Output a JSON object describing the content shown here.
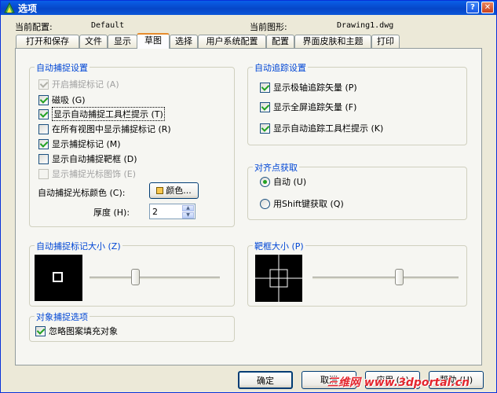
{
  "title": "选项",
  "header": {
    "current_profile_label": "当前配置:",
    "current_profile_value": "Default",
    "current_drawing_label": "当前图形:",
    "current_drawing_value": "Drawing1.dwg"
  },
  "tabs": [
    "打开和保存",
    "文件",
    "显示",
    "草图",
    "选择",
    "用户系统配置",
    "配置",
    "界面皮肤和主题",
    "打印"
  ],
  "active_tab": "草图",
  "autosnap": {
    "title": "自动捕捉设置",
    "items": [
      {
        "label": "开启捕捉标记 (A)",
        "checked": true,
        "disabled": true
      },
      {
        "label": "磁吸 (G)",
        "checked": true,
        "disabled": false
      },
      {
        "label": "显示自动捕捉工具栏提示 (T)",
        "checked": true,
        "disabled": false
      },
      {
        "label": "在所有视图中显示捕捉标记 (R)",
        "checked": false,
        "disabled": false
      },
      {
        "label": "显示捕捉标记 (M)",
        "checked": true,
        "disabled": false
      },
      {
        "label": "显示自动捕捉靶框 (D)",
        "checked": false,
        "disabled": false
      },
      {
        "label": "显示捕捉光标图饰 (E)",
        "checked": false,
        "disabled": true
      }
    ],
    "color_label": "自动捕捉光标颜色 (C):",
    "color_button": "颜色...",
    "color_swatch": "#f9c74f",
    "thickness_label": "厚度 (H):",
    "thickness_value": "2"
  },
  "autotrack": {
    "title": "自动追踪设置",
    "items": [
      {
        "label": "显示极轴追踪矢量 (P)",
        "checked": true
      },
      {
        "label": "显示全屏追踪矢量 (F)",
        "checked": true
      },
      {
        "label": "显示自动追踪工具栏提示 (K)",
        "checked": true
      }
    ]
  },
  "alignment": {
    "title": "对齐点获取",
    "options": [
      {
        "label": "自动 (U)",
        "selected": true
      },
      {
        "label": "用Shift键获取 (Q)",
        "selected": false
      }
    ]
  },
  "marker_size": {
    "title": "自动捕捉标记大小 (Z)",
    "slider_level": 0.34
  },
  "aperture_size": {
    "title": "靶框大小 (P)",
    "slider_level": 0.6
  },
  "object_snap": {
    "title": "对象捕捉选项",
    "items": [
      {
        "label": "忽略图案填充对象",
        "checked": true
      }
    ]
  },
  "buttons": {
    "ok": "确定",
    "cancel": "取消",
    "apply": "应用 (A)",
    "help": "帮助 (H)"
  },
  "watermark": "三维网 www.3dportal.cn"
}
